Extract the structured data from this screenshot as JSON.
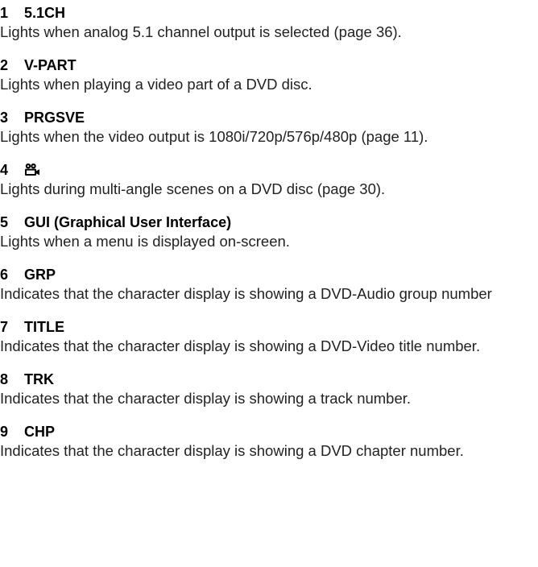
{
  "entries": [
    {
      "num": "1",
      "term": "5.1CH",
      "desc": "Lights when analog 5.1 channel output is selected (page 36)."
    },
    {
      "num": "2",
      "term": "V-PART",
      "desc": "Lights when playing a video part of a DVD disc."
    },
    {
      "num": "3",
      "term": "PRGSVE",
      "desc": "Lights when the video output is 1080i/720p/576p/480p (page 11)."
    },
    {
      "num": "4",
      "term": "",
      "icon": "camera-angle-icon",
      "desc": "Lights during multi-angle scenes on a DVD disc (page 30)."
    },
    {
      "num": "5",
      "term": "GUI (Graphical User Interface)",
      "desc": "Lights when a menu is displayed on-screen."
    },
    {
      "num": "6",
      "term": "GRP",
      "desc": "Indicates that the character display is showing a DVD-Audio group number"
    },
    {
      "num": "7",
      "term": "TITLE",
      "desc": "Indicates that the character display is showing a DVD-Video title number."
    },
    {
      "num": "8",
      "term": "TRK",
      "desc": "Indicates that the character display is showing a track number."
    },
    {
      "num": "9",
      "term": "CHP",
      "desc": "Indicates that the character display is showing a DVD chapter number."
    }
  ]
}
